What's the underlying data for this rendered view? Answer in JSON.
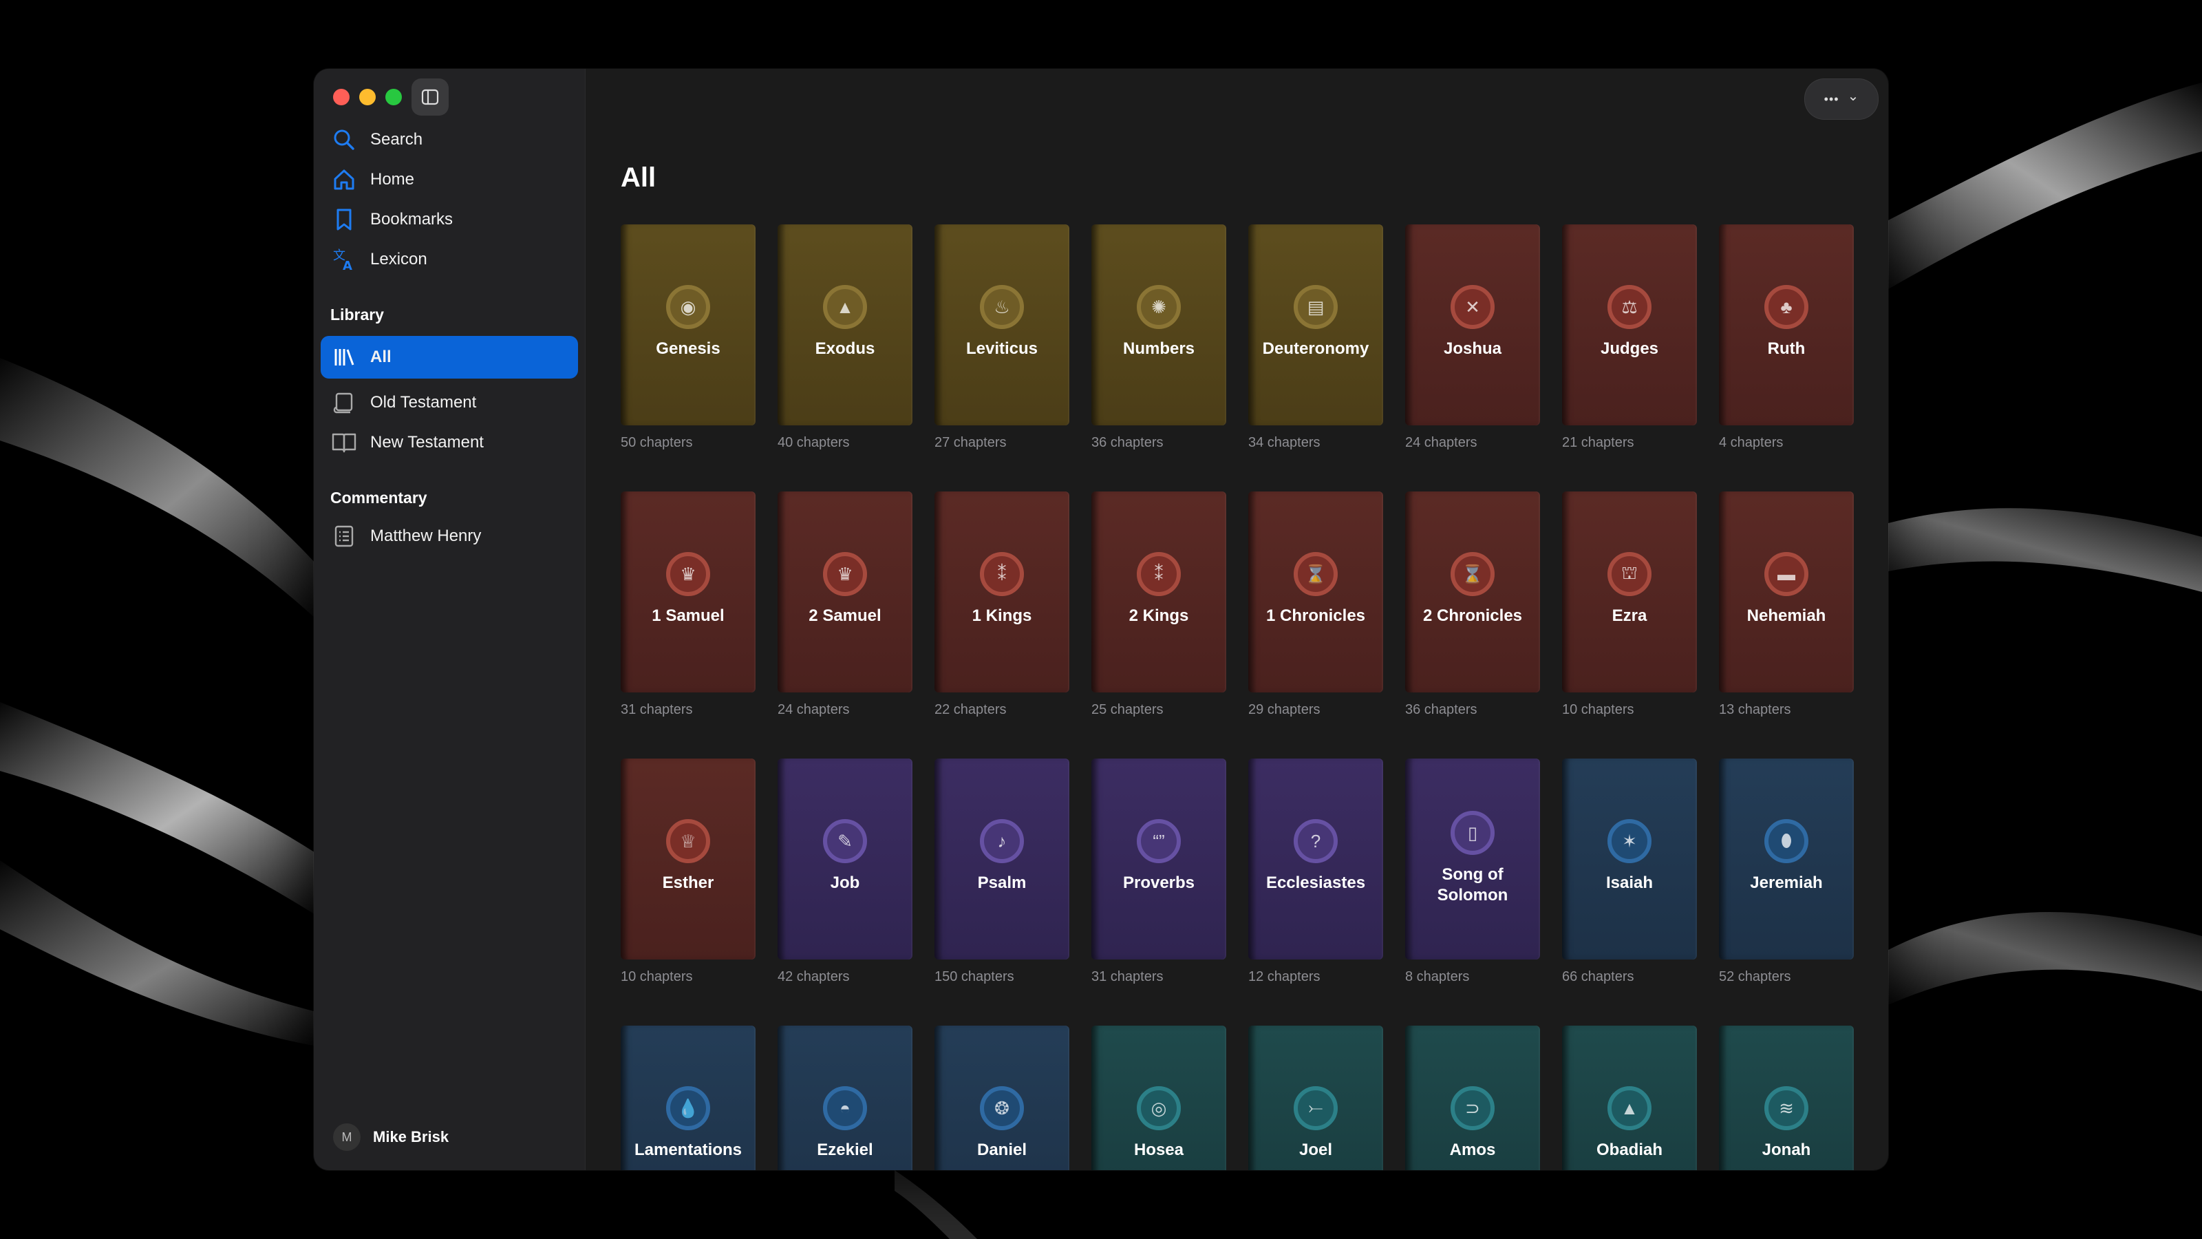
{
  "sidebar": {
    "nav": [
      {
        "label": "Search",
        "icon": "search-icon"
      },
      {
        "label": "Home",
        "icon": "home-icon"
      },
      {
        "label": "Bookmarks",
        "icon": "bookmark-icon"
      },
      {
        "label": "Lexicon",
        "icon": "translate-icon"
      }
    ],
    "library_title": "Library",
    "library": [
      {
        "label": "All",
        "icon": "library-books-icon",
        "active": true
      },
      {
        "label": "Old Testament",
        "icon": "scroll-icon"
      },
      {
        "label": "New Testament",
        "icon": "open-book-icon"
      }
    ],
    "commentary_title": "Commentary",
    "commentary": [
      {
        "label": "Matthew Henry",
        "icon": "commentary-list-icon"
      }
    ],
    "user": {
      "initial": "M",
      "name": "Mike Brisk"
    }
  },
  "toolbar": {
    "more_label": "•••",
    "chevron": "⌄"
  },
  "main": {
    "title": "All"
  },
  "books": [
    {
      "name": "Genesis",
      "chapters": "50 chapters",
      "color": "gold",
      "icon": "sun-icon",
      "glyph": "◉"
    },
    {
      "name": "Exodus",
      "chapters": "40 chapters",
      "color": "gold",
      "icon": "mountain-icon",
      "glyph": "▲"
    },
    {
      "name": "Leviticus",
      "chapters": "27 chapters",
      "color": "gold",
      "icon": "altar-icon",
      "glyph": "♨"
    },
    {
      "name": "Numbers",
      "chapters": "36 chapters",
      "color": "gold",
      "icon": "burst-icon",
      "glyph": "✺"
    },
    {
      "name": "Deuteronomy",
      "chapters": "34 chapters",
      "color": "gold",
      "icon": "tablets-icon",
      "glyph": "▤"
    },
    {
      "name": "Joshua",
      "chapters": "24 chapters",
      "color": "red",
      "icon": "crossed-swords-icon",
      "glyph": "✕"
    },
    {
      "name": "Judges",
      "chapters": "21 chapters",
      "color": "red",
      "icon": "gavel-icon",
      "glyph": "⚖"
    },
    {
      "name": "Ruth",
      "chapters": "4 chapters",
      "color": "red",
      "icon": "wheat-icon",
      "glyph": "♣"
    },
    {
      "name": "1 Samuel",
      "chapters": "31 chapters",
      "color": "red",
      "icon": "crown-icon",
      "glyph": "♛"
    },
    {
      "name": "2 Samuel",
      "chapters": "24 chapters",
      "color": "red",
      "icon": "crown-icon",
      "glyph": "♛"
    },
    {
      "name": "1 Kings",
      "chapters": "22 chapters",
      "color": "red",
      "icon": "temple-icon",
      "glyph": "⁑"
    },
    {
      "name": "2 Kings",
      "chapters": "25 chapters",
      "color": "red",
      "icon": "temple-icon",
      "glyph": "⁑"
    },
    {
      "name": "1 Chronicles",
      "chapters": "29 chapters",
      "color": "red",
      "icon": "hourglass-icon",
      "glyph": "⌛"
    },
    {
      "name": "2 Chronicles",
      "chapters": "36 chapters",
      "color": "red",
      "icon": "hourglass-icon",
      "glyph": "⌛"
    },
    {
      "name": "Ezra",
      "chapters": "10 chapters",
      "color": "red",
      "icon": "gate-icon",
      "glyph": "⛫"
    },
    {
      "name": "Nehemiah",
      "chapters": "13 chapters",
      "color": "red",
      "icon": "wall-icon",
      "glyph": "▬"
    },
    {
      "name": "Esther",
      "chapters": "10 chapters",
      "color": "red",
      "icon": "crown-icon",
      "glyph": "♕"
    },
    {
      "name": "Job",
      "chapters": "42 chapters",
      "color": "purple",
      "icon": "feather-icon",
      "glyph": "✎"
    },
    {
      "name": "Psalm",
      "chapters": "150 chapters",
      "color": "purple",
      "icon": "music-note-icon",
      "glyph": "♪"
    },
    {
      "name": "Proverbs",
      "chapters": "31 chapters",
      "color": "purple",
      "icon": "quote-icon",
      "glyph": "“”"
    },
    {
      "name": "Ecclesiastes",
      "chapters": "12 chapters",
      "color": "purple",
      "icon": "question-icon",
      "glyph": "?"
    },
    {
      "name": "Song of Solomon",
      "chapters": "8 chapters",
      "color": "purple",
      "icon": "candle-icon",
      "glyph": "▯"
    },
    {
      "name": "Isaiah",
      "chapters": "66 chapters",
      "color": "blue",
      "icon": "seraph-icon",
      "glyph": "✶"
    },
    {
      "name": "Jeremiah",
      "chapters": "52 chapters",
      "color": "blue",
      "icon": "tear-icon",
      "glyph": "⬮"
    },
    {
      "name": "Lamentations",
      "chapters": "",
      "color": "blue",
      "icon": "drop-icon",
      "glyph": "💧"
    },
    {
      "name": "Ezekiel",
      "chapters": "",
      "color": "blue",
      "icon": "wheel-icon",
      "glyph": "◓"
    },
    {
      "name": "Daniel",
      "chapters": "",
      "color": "blue",
      "icon": "lion-icon",
      "glyph": "❂"
    },
    {
      "name": "Hosea",
      "chapters": "",
      "color": "teal",
      "icon": "ring-icon",
      "glyph": "◎"
    },
    {
      "name": "Joel",
      "chapters": "",
      "color": "teal",
      "icon": "locust-icon",
      "glyph": "⤚"
    },
    {
      "name": "Amos",
      "chapters": "",
      "color": "teal",
      "icon": "plumb-line-icon",
      "glyph": "⊃"
    },
    {
      "name": "Obadiah",
      "chapters": "",
      "color": "teal",
      "icon": "mountain-peak-icon",
      "glyph": "▲"
    },
    {
      "name": "Jonah",
      "chapters": "",
      "color": "teal",
      "icon": "whale-icon",
      "glyph": "≋"
    }
  ]
}
